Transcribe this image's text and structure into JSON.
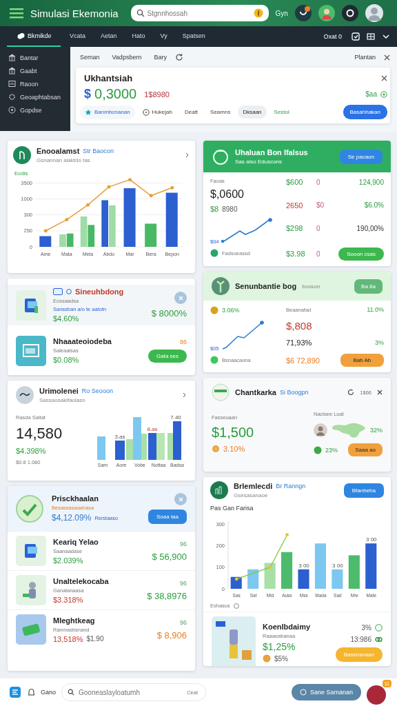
{
  "header": {
    "title": "Simulasi Ekemonia",
    "search_placeholder": "Stgnnhossah",
    "user_label": "Gyn"
  },
  "nav": {
    "tabs": [
      {
        "label": "Bkmikde",
        "selected": true
      },
      {
        "label": "Vcata",
        "selected": false
      },
      {
        "label": "Aetan",
        "selected": false
      },
      {
        "label": "Hato",
        "selected": false
      },
      {
        "label": "Vy",
        "selected": false
      },
      {
        "label": "Spatsen",
        "selected": false
      }
    ],
    "right_label": "Oxat 0"
  },
  "sidebar": {
    "items": [
      {
        "label": "Bantar",
        "kind": "bank"
      },
      {
        "label": "Gaabt",
        "kind": "bank"
      },
      {
        "label": "Raoon",
        "kind": "chart"
      },
      {
        "label": "Geoaphtabsan",
        "kind": "gear"
      },
      {
        "label": "Gopdse",
        "kind": "help"
      }
    ]
  },
  "subbar": {
    "links": [
      "Seman",
      "Vadpsbern",
      "Bary"
    ],
    "right_label": "Plantan"
  },
  "summary": {
    "title": "Ukhantsiah",
    "currency": "$",
    "amount": "0,3000",
    "change": "1$8980",
    "badge": "$aa",
    "button": "Basahhakan",
    "filters": [
      {
        "label": "Banmbcnanan",
        "kind": "star",
        "selected": false
      },
      {
        "label": "Hukejah",
        "kind": "clock",
        "selected": false
      },
      {
        "label": "Deatt",
        "kind": "plain",
        "selected": false
      },
      {
        "label": "Seamns",
        "kind": "plain",
        "selected": false
      },
      {
        "label": "Dksaan",
        "kind": "plain",
        "selected": true
      },
      {
        "label": "Sestol",
        "kind": "accent",
        "selected": false
      }
    ]
  },
  "chart_card": {
    "title": "Enooalamst",
    "tag": "Str Baocon",
    "subtitle": "Gsnannan aiaktdo tas",
    "axis_title": "Ecdis",
    "y_labels": [
      "3500",
      "1000",
      "300",
      "250",
      "0"
    ],
    "x_labels": [
      "Ame",
      "Mata",
      "Meta",
      "Abdo",
      "Mar",
      "Bera",
      "Bepon"
    ]
  },
  "market_card": {
    "title": "Uhaluan Bon Ifalsus",
    "subtitle": "Sas aiso Eduscons",
    "button": "Se pacaon",
    "label": "Faoas",
    "amount": "$,0600",
    "sub_value": "$8",
    "sub_text": "8980",
    "spark_label": "$04",
    "footer": "Fadsoeassd",
    "rows": [
      {
        "value": "$600",
        "negative": false,
        "mark": "0",
        "figure": "124,900",
        "figure_muted": false
      },
      {
        "value": "2650",
        "negative": true,
        "mark": "$0",
        "figure": "$6.0%",
        "figure_muted": false
      },
      {
        "value": "$298",
        "negative": false,
        "mark": "0",
        "figure": "190,00%",
        "figure_muted": true
      }
    ],
    "last_row": {
      "value": "$3.98",
      "negative": false,
      "mark": "0",
      "button": "Sooon csas"
    }
  },
  "product_list": {
    "items": [
      {
        "title": "Sineuhbdong",
        "highlighted": true,
        "label": "Eossaadsa",
        "detail": "Sanssban a/o te aatotn",
        "change": "$4.60%",
        "price": "$ 8000%",
        "kind": "book"
      },
      {
        "title": "Nhaaateoiodeba",
        "highlighted": false,
        "label": "Saleaalsas",
        "change": "$0.08%",
        "badge": "86",
        "button": "Gata ses",
        "kind": "screen"
      }
    ]
  },
  "rate_card": {
    "title": "Senunbantie bog",
    "tag": "booson",
    "button": "Ba 8a",
    "rate": "3.06%",
    "spark_label": "$05",
    "footer": "Bsnaacaona",
    "label": "Beaanafad",
    "amount": "$,808",
    "amount_change": "11.0%",
    "value": "71,93%",
    "value_change": "3%",
    "total": "$6 72,890",
    "total_button": "Bab Ab"
  },
  "stats_card": {
    "title": "Urimolenei",
    "tag": "Ro Seooon",
    "subtitle": "Sassaosakifaolasn",
    "label": "Rasda Saltat",
    "amount": "14,580",
    "change": "$4.398%",
    "note": "$0.8 1.080",
    "bars": {
      "labels": [
        "Sam",
        "Aore",
        "Vobe",
        "Nottaa",
        "Badsa"
      ],
      "value_labels": [
        "3.as",
        "8.as",
        "7.40"
      ]
    }
  },
  "region_card": {
    "title": "Chantkarka",
    "tag": "Si Boogpn",
    "count": "1$66",
    "label": "Fasseuaan",
    "amount": "$1,500",
    "change": "3.10%",
    "region_label": "Nacisee Luat",
    "region_share": "32%",
    "region_change": "23%",
    "button": "Saaa ao"
  },
  "promo_list": {
    "featured": {
      "title": "Prisckhaalan",
      "subtitle": "Besassasaaahasa",
      "value": "$4,12.09%",
      "note": "Rsrstaaso",
      "button": "Soaa taa"
    },
    "items": [
      {
        "title": "Keariq Yelao",
        "subtitle": "Saanaadase",
        "change": "$2.039%",
        "negative": false,
        "badge": "96",
        "price": "$ 56,900",
        "kind": "book"
      },
      {
        "title": "Unaltelekocaba",
        "subtitle": "Ganalanaasa",
        "change": "$3.318%",
        "negative": true,
        "badge": "96",
        "price": "$ 38,8976",
        "kind": "person"
      },
      {
        "title": "Mleghtkeag",
        "subtitle": "Ranmasbsnand",
        "change": "13,518%",
        "negative": true,
        "extra": "$1.90",
        "badge": "96",
        "price": "$ 8,906",
        "kind": "cash"
      }
    ]
  },
  "forecast_card": {
    "title": "Brlemlecdi",
    "tag": "Br Ranngn",
    "subtitle": "Gsesasanaoe",
    "button": "Bfanheha",
    "footer": "Eshasus",
    "chart_title": "Pas Gan Farisa",
    "y_labels": [
      "300",
      "200",
      "100",
      "0"
    ],
    "x_labels": [
      "Sas",
      "Sat",
      "Mid",
      "Ause",
      "Mse",
      "Mada",
      "Sad",
      "Mre",
      "Mate"
    ],
    "value_labels": [
      "3 00",
      "3 00",
      "3 00"
    ],
    "item": {
      "title": "Koenlbdaimy",
      "subtitle": "Raaaeabanaa",
      "change": "$1,25%",
      "share": "3%",
      "figure": "13:986",
      "note": "$5%",
      "button": "Bassnsnaan"
    }
  },
  "bottom_bar": {
    "label": "Gano",
    "search_placeholder": "Gooneaslayloatumh",
    "search_hint": "Ceat",
    "button": "Sane Samanan",
    "badge": "11"
  }
}
